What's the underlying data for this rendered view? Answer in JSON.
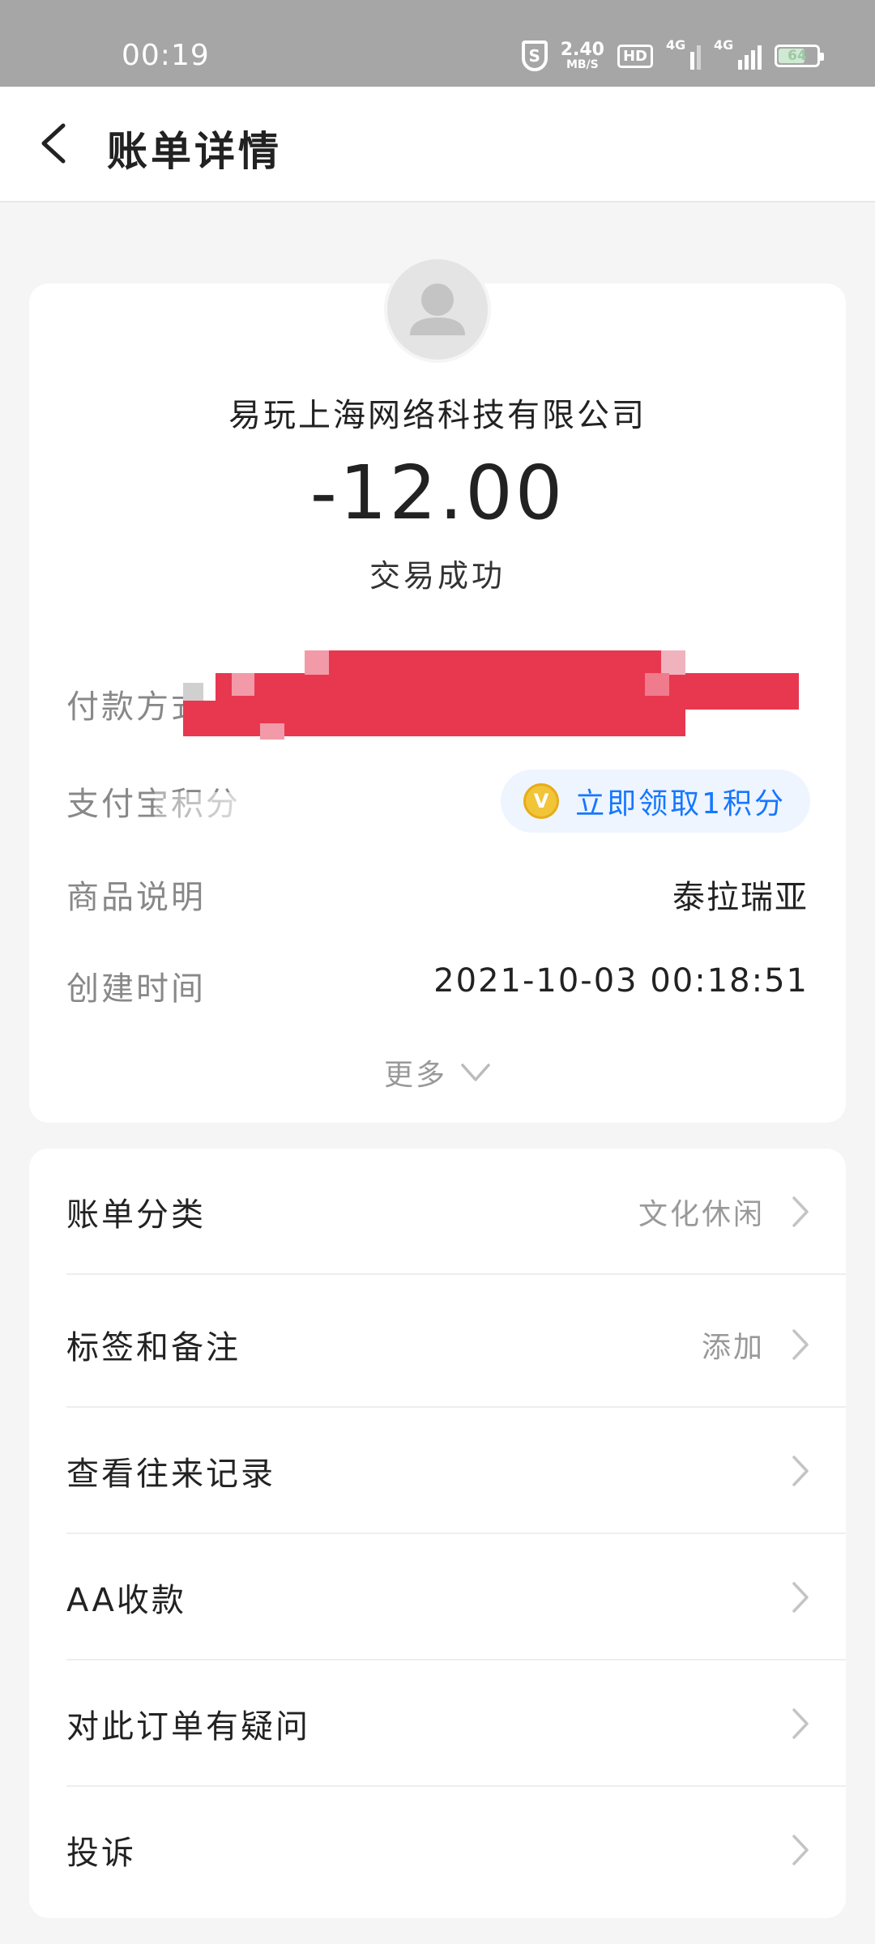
{
  "status_bar": {
    "time": "00:19",
    "shield_label": "S",
    "speed_value": "2.40",
    "speed_unit": "MB/S",
    "hd_label": "HD",
    "sim1_label": "4G",
    "sim2_label": "4G",
    "battery_level": "64"
  },
  "nav": {
    "title": "账单详情",
    "back_icon": "chevron-left-icon"
  },
  "bill": {
    "merchant": "易玩上海网络科技有限公司",
    "amount": "-12.00",
    "status": "交易成功",
    "rows": [
      {
        "label": "付款方式",
        "value": ""
      },
      {
        "label": "支付宝积分",
        "value": ""
      },
      {
        "label": "商品说明",
        "value": "泰拉瑞亚"
      },
      {
        "label": "创建时间",
        "value": "2021-10-03 00:18:51"
      }
    ],
    "points_button": "立即领取1积分",
    "points_coin_glyph": "V",
    "more_label": "更多"
  },
  "menu": {
    "items": [
      {
        "label": "账单分类",
        "value": "文化休闲"
      },
      {
        "label": "标签和备注",
        "value": "添加"
      },
      {
        "label": "查看往来记录",
        "value": ""
      },
      {
        "label": "AA收款",
        "value": ""
      },
      {
        "label": "对此订单有疑问",
        "value": ""
      },
      {
        "label": "投诉",
        "value": ""
      }
    ]
  },
  "colors": {
    "redaction": "#e8384f",
    "link_blue": "#1677ff",
    "coin_gold": "#f2c438"
  }
}
